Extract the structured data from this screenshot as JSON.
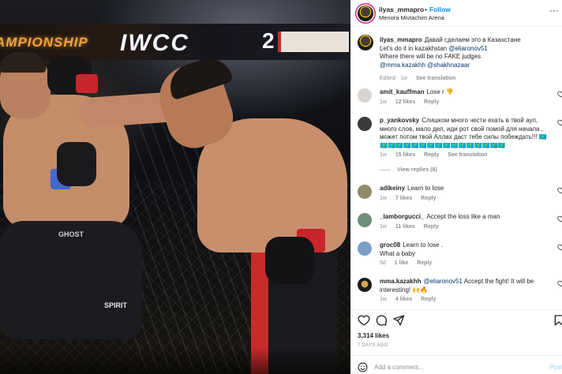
{
  "post": {
    "username": "ilyas_mmapro",
    "follow_label": "Follow",
    "location": "Menora Mivtachim Arena",
    "caption_lines": [
      "Давай сделаем это в Казахстане",
      "Let's do it in kazakhstan ",
      "Where there will be no FAKE judges"
    ],
    "caption_mention_1": "@eliaronov51",
    "caption_mentions_line": "@mma.kazakhh @shakhnazaar",
    "caption_meta": {
      "edited": "Edited · 1w",
      "translate": "See translation"
    }
  },
  "media": {
    "banner_left": "AMPIONSHIP",
    "banner_logo": "IWCC",
    "banner_num": "2",
    "shorts_left": "GHOST",
    "shorts_left_brand": "SPIRIT"
  },
  "comments": [
    {
      "user": "amit_kauffman",
      "text": "Lose r 👎",
      "time": "1w",
      "likes": "12 likes",
      "reply": "Reply",
      "avatar_color": "#d8d4cf"
    },
    {
      "user": "p_yankovsky",
      "text": "Слишком много чести ехать в твой аул, много слов, мало дел, иди рот свой помой для начала , может потом твой Аллах даст тебе силы побеждать!!! 🇰🇿🇰🇿🇰🇿🇰🇿🇰🇿🇰🇿🇰🇿🇰🇿🇰🇿🇰🇿🇰🇿🇰🇿🇰🇿🇰🇿🇰🇿🇰🇿🇰🇿",
      "time": "1w",
      "likes": "15 likes",
      "reply": "Reply",
      "translate": "See translation",
      "avatar_color": "#3a3a3a",
      "view_replies": "View replies (8)"
    },
    {
      "user": "adikeiny",
      "text": "Learn to lose",
      "time": "1w",
      "likes": "7 likes",
      "reply": "Reply",
      "avatar_color": "#8f8a6a"
    },
    {
      "user": "_lamborgucci_",
      "text": "Accept the loss like a man",
      "time": "1w",
      "likes": "11 likes",
      "reply": "Reply",
      "avatar_color": "#6f8f7a"
    },
    {
      "user": "groc08",
      "text": "Learn to lose .",
      "text2": "What a baby",
      "time": "5d",
      "likes": "1 like",
      "reply": "Reply",
      "avatar_color": "#7aa0c8"
    },
    {
      "user": "mma.kazakhh",
      "mention": "@eliaronov51",
      "text": "Accept the fight! It will be interesting! 🙌🔥",
      "time": "1w",
      "likes": "4 likes",
      "reply": "Reply",
      "avatar_color": "#1a1a1a"
    }
  ],
  "footer": {
    "likes": "3,314 likes",
    "date": "7 DAYS AGO",
    "comment_placeholder": "Add a comment...",
    "post_label": "Post"
  },
  "colors": {
    "accent": "#0095f6",
    "text": "#262626",
    "muted": "#8e8e8e",
    "mention": "#00376b"
  }
}
